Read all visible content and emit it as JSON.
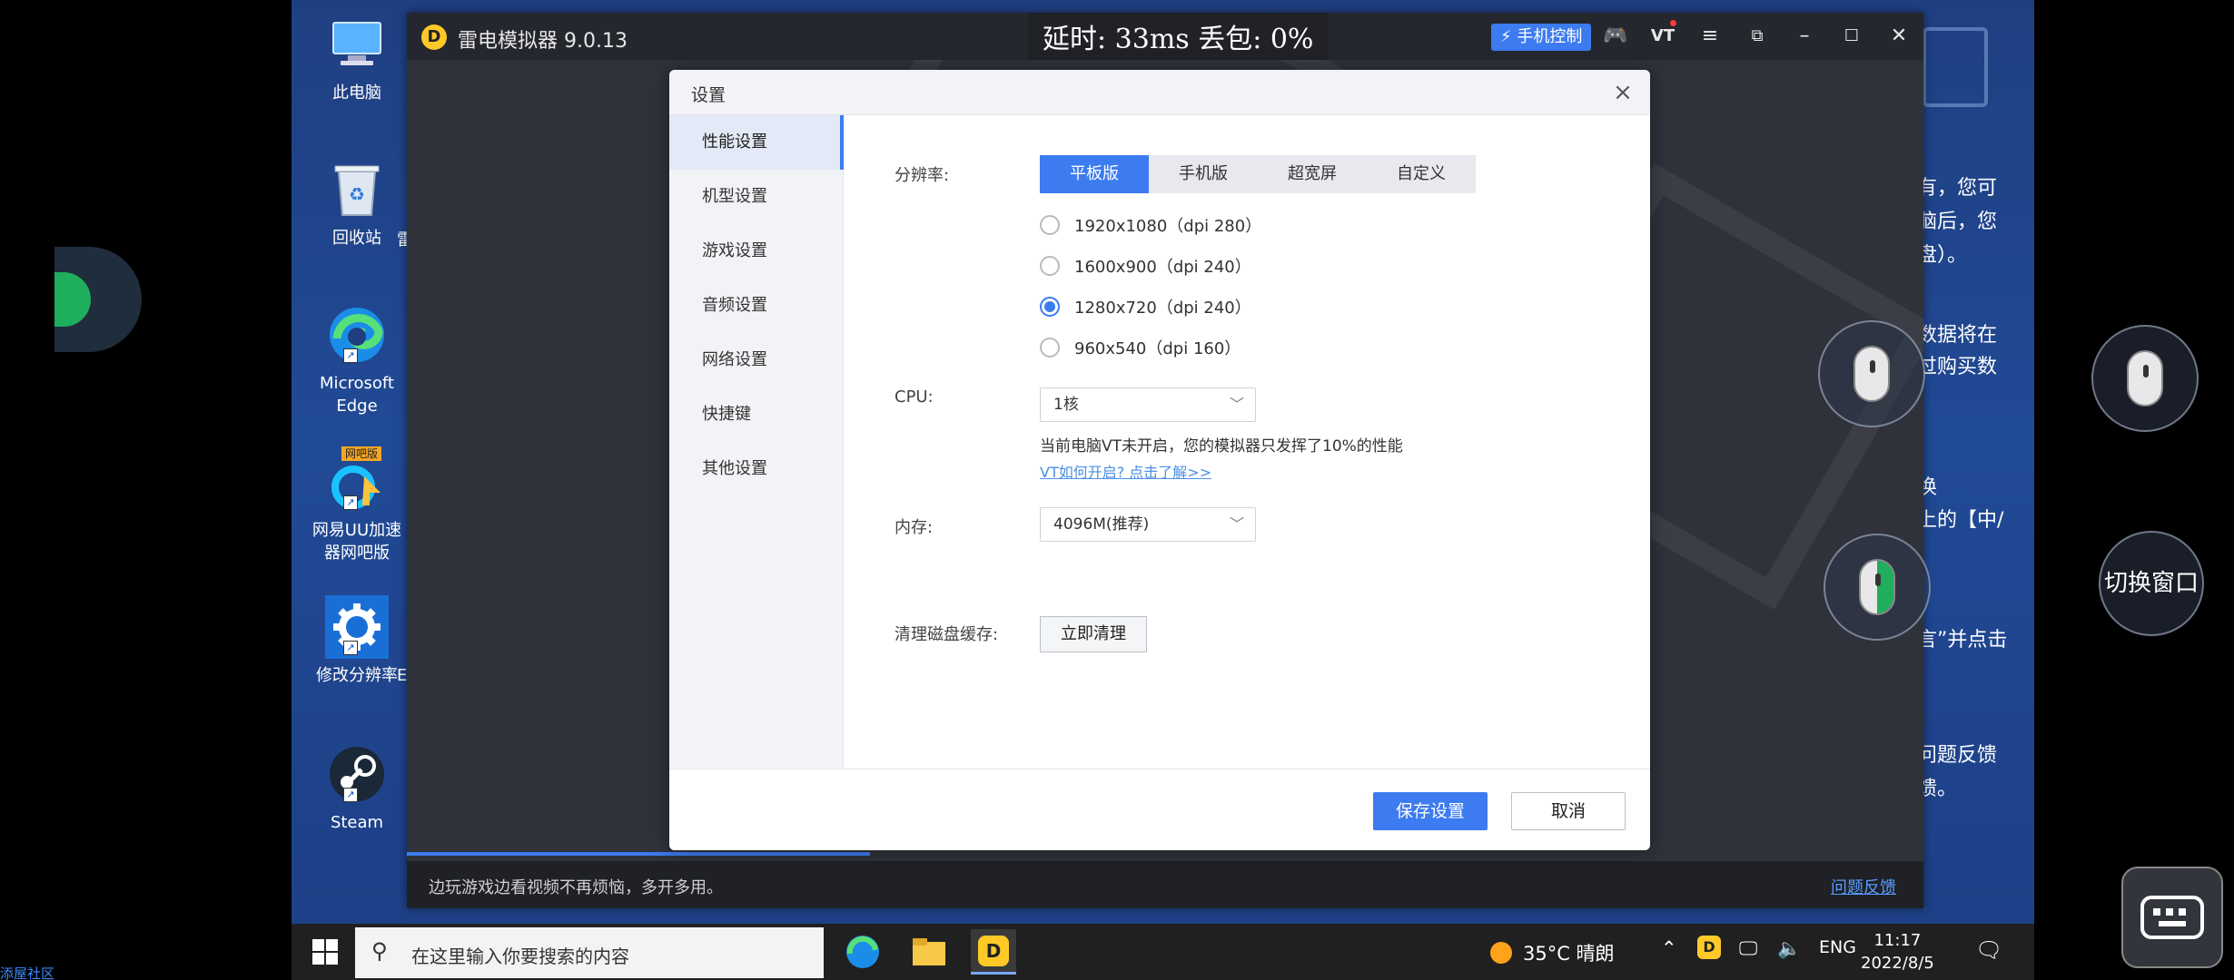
{
  "desktop_icons": [
    {
      "name": "this-pc",
      "label": "此电脑"
    },
    {
      "name": "recycle-bin",
      "label": "回收站"
    },
    {
      "name": "edge",
      "label": "Microsoft Edge"
    },
    {
      "name": "uu-booster",
      "badge": "网吧版",
      "label": "网易UU加速器网吧版"
    },
    {
      "name": "change-resolution",
      "label": "修改分辨率"
    },
    {
      "name": "steam",
      "label": "Steam"
    }
  ],
  "desktop_icon_partials": {
    "recycle": "雷",
    "resolution": "E"
  },
  "article_fragments": [
    "有，您可",
    "脑后，您",
    "盘）。",
    "数据将在",
    "过购买数",
    "换",
    "上的【中/",
    "言”并点击",
    "问题反馈",
    "馈。"
  ],
  "emulator": {
    "title": "雷电模拟器 9.0.13",
    "logo_glyph": "D",
    "latency_overlay": "延时: 33ms 丢包: 0%",
    "phone_control_label": "手机控制",
    "vt_label": "VT",
    "footer_text": "边玩游戏边看视频不再烦恼，多开多用。",
    "feedback_link": "问题反馈"
  },
  "settings": {
    "title": "设置",
    "sidebar": [
      {
        "label": "性能设置",
        "active": true
      },
      {
        "label": "机型设置",
        "active": false
      },
      {
        "label": "游戏设置",
        "active": false
      },
      {
        "label": "音频设置",
        "active": false
      },
      {
        "label": "网络设置",
        "active": false
      },
      {
        "label": "快捷键",
        "active": false
      },
      {
        "label": "其他设置",
        "active": false
      }
    ],
    "resolution_label": "分辨率:",
    "resolution_tabs": [
      {
        "label": "平板版",
        "active": true
      },
      {
        "label": "手机版",
        "active": false
      },
      {
        "label": "超宽屏",
        "active": false
      },
      {
        "label": "自定义",
        "active": false
      }
    ],
    "resolution_options": [
      {
        "label": "1920x1080（dpi 280）",
        "selected": false
      },
      {
        "label": "1600x900（dpi 240）",
        "selected": false
      },
      {
        "label": "1280x720（dpi 240）",
        "selected": true
      },
      {
        "label": "960x540（dpi 160）",
        "selected": false
      }
    ],
    "cpu_label": "CPU:",
    "cpu_value": "1核",
    "vt_note": "当前电脑VT未开启，您的模拟器只发挥了10%的性能",
    "vt_link": "VT如何开启? 点击了解>>",
    "memory_label": "内存:",
    "memory_value": "4096M(推荐)",
    "disk_cache_label": "清理磁盘缓存:",
    "clear_button": "立即清理",
    "save_button": "保存设置",
    "cancel_button": "取消"
  },
  "taskbar": {
    "search_placeholder": "在这里输入你要搜索的内容",
    "weather": "35°C 晴朗",
    "language": "ENG",
    "time": "11:17",
    "date": "2022/8/5"
  },
  "overlay": {
    "switch_window_label": "切换窗口",
    "community_label": "添屋社区"
  }
}
